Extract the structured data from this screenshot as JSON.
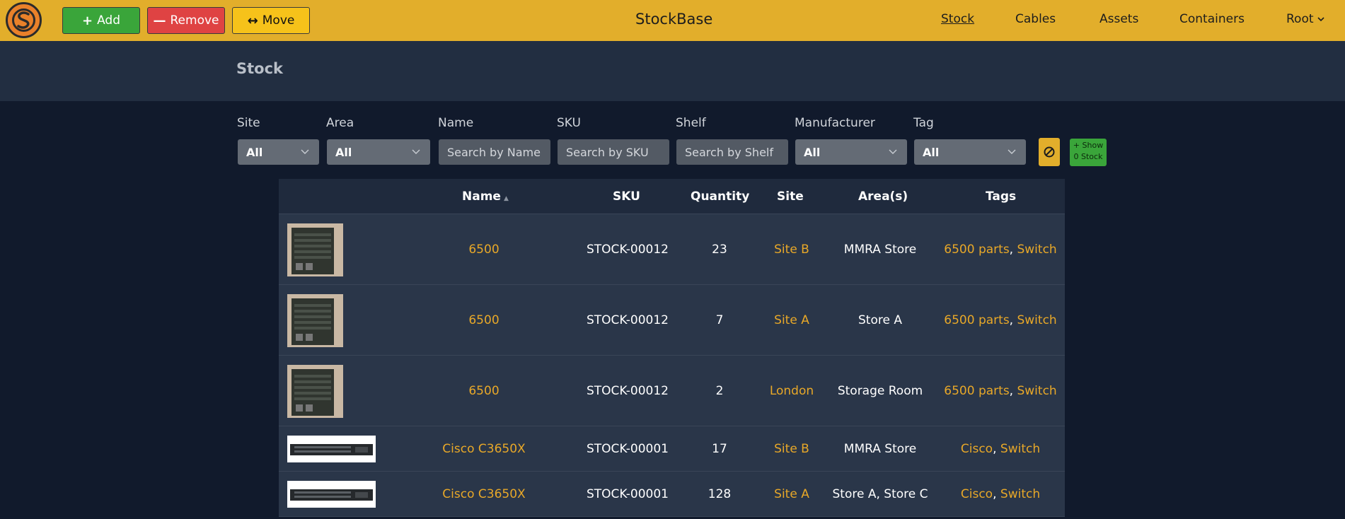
{
  "app": {
    "title": "StockBase"
  },
  "toolbar": {
    "add_label": "Add",
    "remove_label": "Remove",
    "move_label": "Move"
  },
  "nav": {
    "stock": "Stock",
    "cables": "Cables",
    "assets": "Assets",
    "containers": "Containers",
    "root": "Root"
  },
  "page": {
    "title": "Stock"
  },
  "filters": {
    "site": {
      "label": "Site",
      "value": "All"
    },
    "area": {
      "label": "Area",
      "value": "All"
    },
    "name": {
      "label": "Name",
      "placeholder": "Search by Name"
    },
    "sku": {
      "label": "SKU",
      "placeholder": "Search by SKU"
    },
    "shelf": {
      "label": "Shelf",
      "placeholder": "Search by Shelf"
    },
    "manufacturer": {
      "label": "Manufacturer",
      "value": "All"
    },
    "tag": {
      "label": "Tag",
      "value": "All"
    },
    "show_zero": {
      "line1": "+ Show",
      "line2": "0 Stock"
    }
  },
  "table": {
    "headers": {
      "name": "Name",
      "sku": "SKU",
      "quantity": "Quantity",
      "site": "Site",
      "areas": "Area(s)",
      "tags": "Tags"
    },
    "rows": [
      {
        "name": "6500",
        "sku": "STOCK-00012",
        "quantity": "23",
        "site": "Site B",
        "areas": "MMRA Store",
        "tag1": "6500 parts",
        "tag2": "Switch"
      },
      {
        "name": "6500",
        "sku": "STOCK-00012",
        "quantity": "7",
        "site": "Site A",
        "areas": "Store A",
        "tag1": "6500 parts",
        "tag2": "Switch"
      },
      {
        "name": "6500",
        "sku": "STOCK-00012",
        "quantity": "2",
        "site": "London",
        "areas": "Storage Room",
        "tag1": "6500 parts",
        "tag2": "Switch"
      },
      {
        "name": "Cisco C3650X",
        "sku": "STOCK-00001",
        "quantity": "17",
        "site": "Site B",
        "areas": "MMRA Store",
        "tag1": "Cisco",
        "tag2": "Switch"
      },
      {
        "name": "Cisco C3650X",
        "sku": "STOCK-00001",
        "quantity": "128",
        "site": "Site A",
        "areas": "Store A, Store C",
        "tag1": "Cisco",
        "tag2": "Switch"
      }
    ]
  },
  "colors": {
    "accent": "#e2ae2b",
    "link": "#e8a828",
    "add": "#3aa53a",
    "remove": "#df4343",
    "move": "#f6c21a"
  },
  "icons": {
    "logo": "stockbase-logo",
    "add": "plus-icon",
    "remove": "minus-icon",
    "move": "arrows-horizontal-icon",
    "clear": "cancel-icon",
    "dropdown": "chevron-down-icon"
  }
}
